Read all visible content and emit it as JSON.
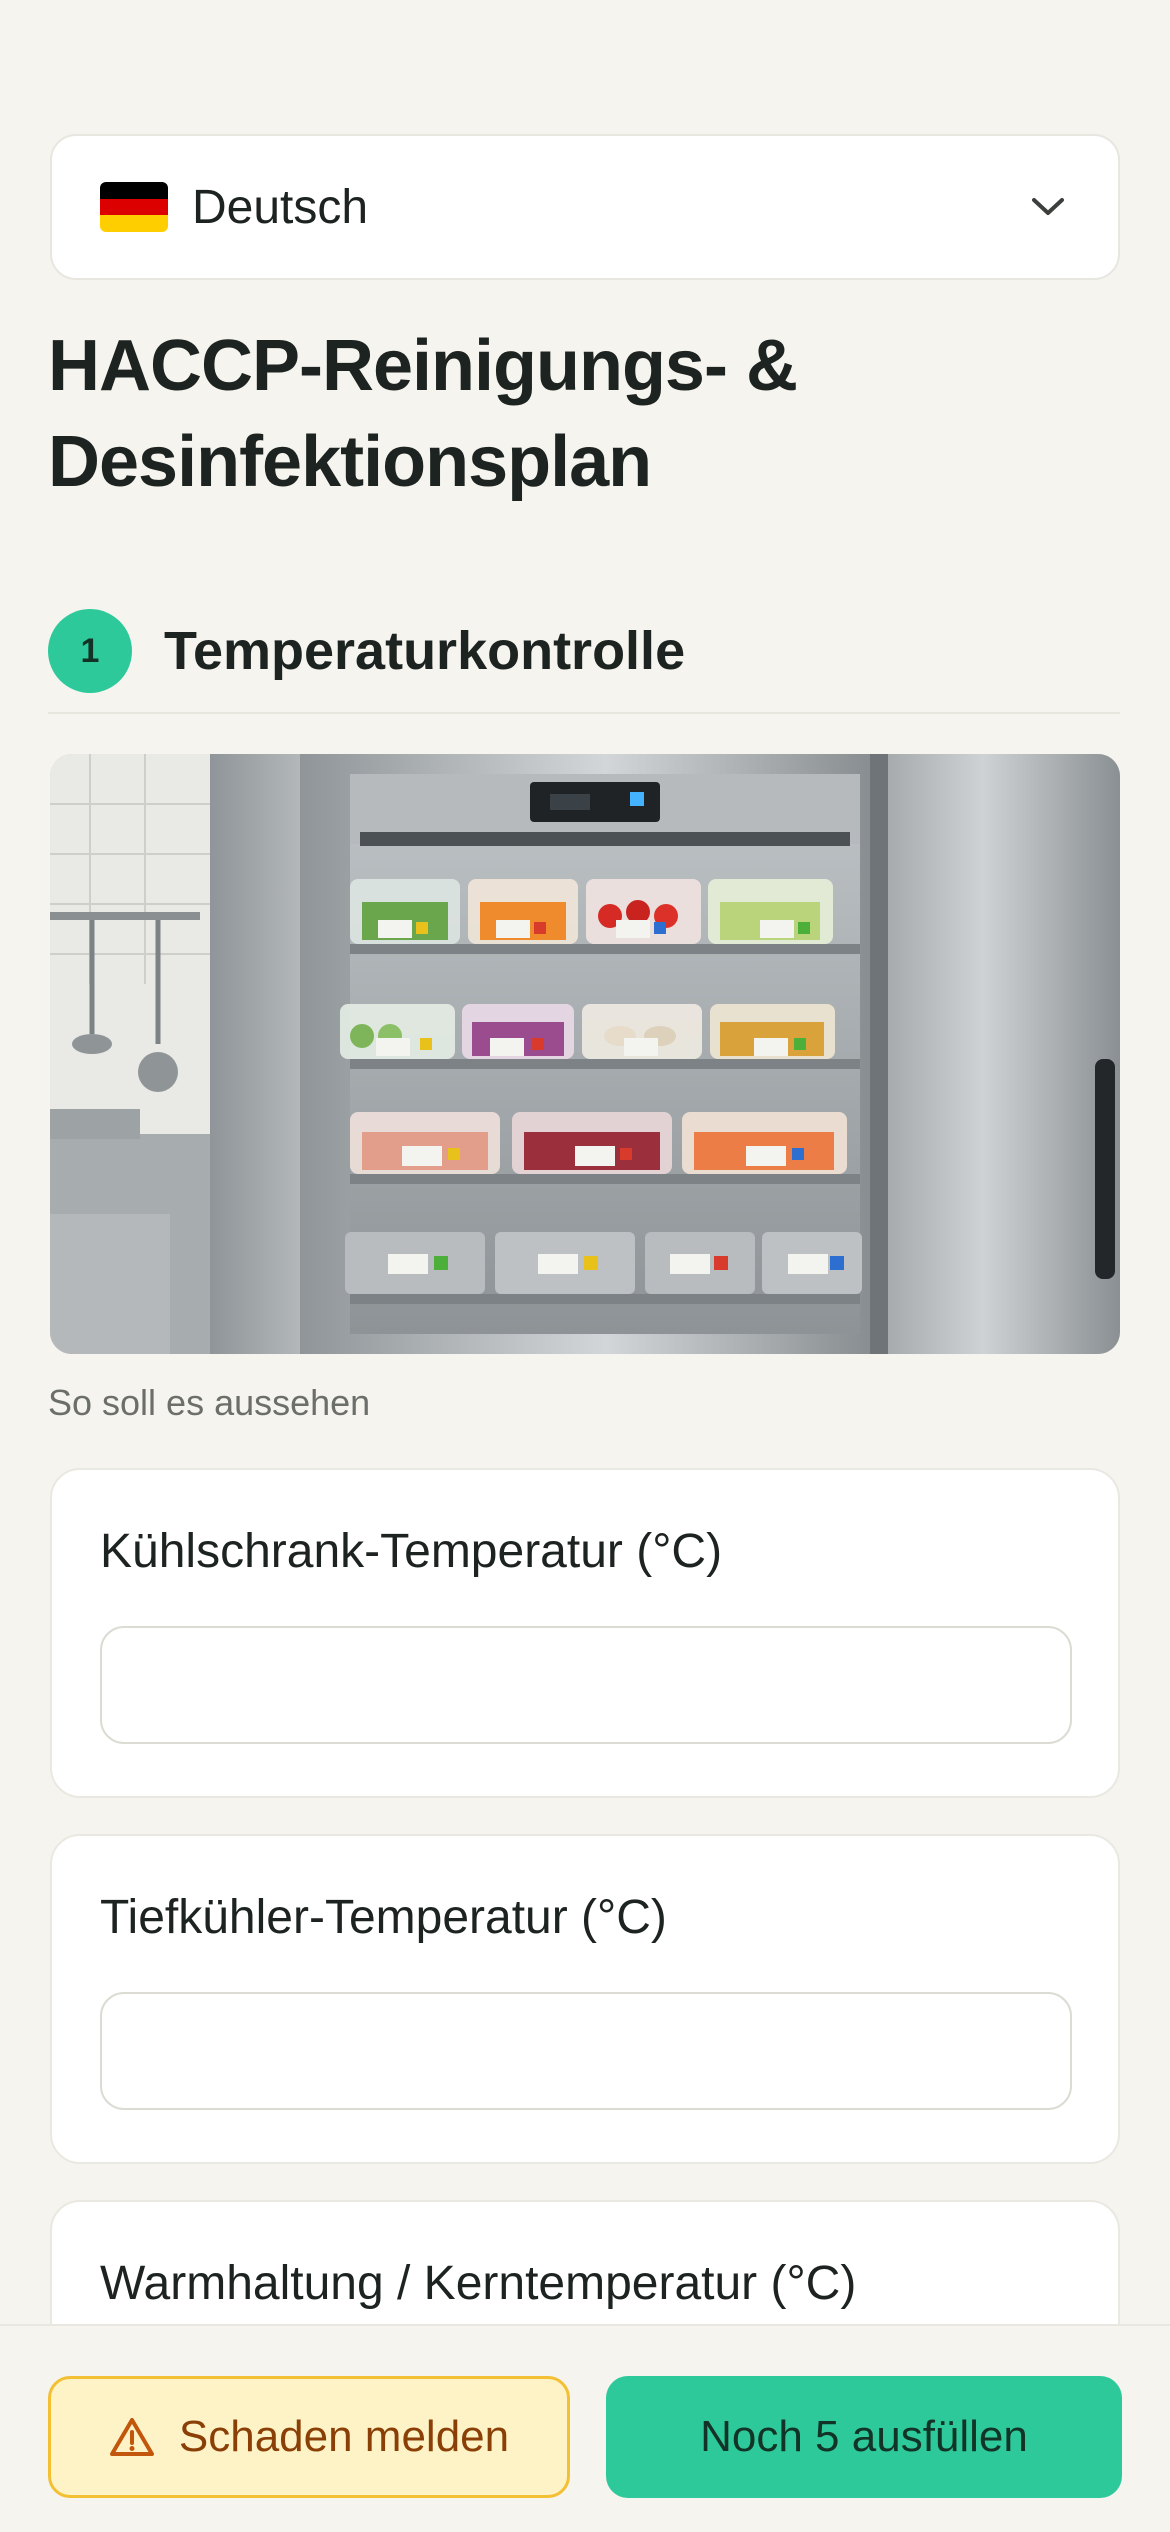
{
  "language_selector": {
    "label": "Deutsch",
    "flag_icon": "germany-flag-icon",
    "flag_colors": [
      "#000000",
      "#dd0000",
      "#ffce00"
    ],
    "chevron_icon": "chevron-down-icon"
  },
  "page": {
    "title": "HACCP-Reinigungs- & Desinfektionsplan"
  },
  "section": {
    "number": "1",
    "title": "Temperaturkontrolle",
    "accent_color": "#2ec99a",
    "reference_image_caption": "So soll es aussehen"
  },
  "fields": [
    {
      "label": "Kühlschrank-Temperatur (°C)",
      "value": ""
    },
    {
      "label": "Tiefkühler-Temperatur (°C)",
      "value": ""
    },
    {
      "label": "Warmhaltung / Kerntemperatur (°C)",
      "value": ""
    }
  ],
  "footer": {
    "report_button_label": "Schaden melden",
    "report_icon": "warning-triangle-icon",
    "fill_button_label": "Noch 5 ausfüllen"
  }
}
